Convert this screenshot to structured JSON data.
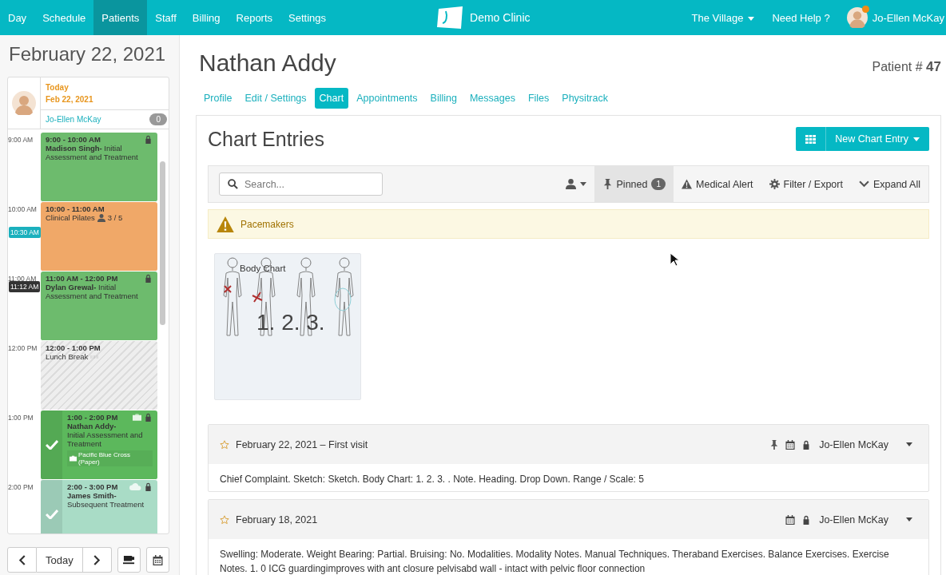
{
  "nav": {
    "items": [
      {
        "label": "Day",
        "selected": false
      },
      {
        "label": "Schedule",
        "selected": false
      },
      {
        "label": "Patients",
        "selected": true
      },
      {
        "label": "Staff",
        "selected": false
      },
      {
        "label": "Billing",
        "selected": false
      },
      {
        "label": "Reports",
        "selected": false
      },
      {
        "label": "Settings",
        "selected": false
      }
    ],
    "brand": "Demo Clinic",
    "location": "The Village",
    "help": "Need Help ?",
    "user": "Jo-Ellen McKay"
  },
  "sidebar": {
    "date": "February 22, 2021",
    "day_label": "Today",
    "day_date": "Feb 22, 2021",
    "staff": "Jo-Ellen McKay",
    "staff_count": "0",
    "times": [
      "9:00 AM",
      "10:00 AM",
      "11:00 AM",
      "12:00 PM",
      "1:00 PM",
      "2:00 PM"
    ],
    "markers": [
      {
        "kind": "hover",
        "label": "10:30 AM"
      },
      {
        "kind": "now",
        "label": "11:12 AM"
      }
    ],
    "appointments": [
      {
        "kind": "appointment",
        "color": "#6dbb6d",
        "time": "9:00 - 10:00 AM",
        "name": "Madison Singh-",
        "desc": "Initial Assessment and Treatment",
        "insured": false,
        "online": false,
        "locked": true,
        "checked": false
      },
      {
        "kind": "class",
        "color": "#f0a868",
        "time": "10:00 - 11:00 AM",
        "desc": "Clinical Pilates",
        "capacity": "3 / 5"
      },
      {
        "kind": "appointment",
        "color": "#6dbb6d",
        "time": "11:00 AM - 12:00 PM",
        "name": "Dylan Grewal-",
        "desc": "Initial Assessment and Treatment",
        "insured": false,
        "online": false,
        "locked": true,
        "checked": false
      },
      {
        "kind": "break",
        "time": "12:00 - 1:00 PM",
        "desc": "Lunch Break"
      },
      {
        "kind": "appointment",
        "color": "#5cb85c",
        "time": "1:00 - 2:00 PM",
        "name": "Nathan Addy-",
        "desc": "Initial Assessment and Treatment",
        "insurance": "Pacific Blue Cross (Paper)",
        "insured": true,
        "online": false,
        "locked": true,
        "checked": true
      },
      {
        "kind": "appointment",
        "color": "#a9dcc6",
        "time": "2:00 - 3:00 PM",
        "name": "James Smith-",
        "desc": "Subsequent Treatment",
        "insured": false,
        "online": true,
        "locked": true,
        "checked": true
      }
    ],
    "today_button": "Today"
  },
  "patient": {
    "name": "Nathan Addy",
    "number": "Patient # **47**",
    "tabs": [
      {
        "label": "Profile",
        "selected": false
      },
      {
        "label": "Edit / Settings",
        "selected": false
      },
      {
        "label": "Chart",
        "selected": true
      },
      {
        "label": "Appointments",
        "selected": false
      },
      {
        "label": "Billing",
        "selected": false
      },
      {
        "label": "Messages",
        "selected": false
      },
      {
        "label": "Files",
        "selected": false
      },
      {
        "label": "Physitrack",
        "selected": false
      }
    ]
  },
  "chart": {
    "title": "Chart Entries",
    "new_button": "New Chart Entry",
    "search": {
      "placeholder": "Search..."
    },
    "pinned": {
      "label": "Pinned",
      "count": "1",
      "selected": true
    },
    "toolbar": [
      "Medical Alert",
      "Filter / Export",
      "Expand All"
    ],
    "alert": "Pacemakers",
    "body_chart": {
      "label": "Body Chart",
      "text": "1. 2. 3."
    },
    "entries": [
      {
        "title": "February 22, 2021 – First visit",
        "pinned": true,
        "author": "Jo-Ellen McKay",
        "body": "Chief Complaint. Sketch: Sketch. Body Chart: 1. 2. 3. . Note. Heading. Drop Down. Range / Scale: 5"
      },
      {
        "title": "February 18, 2021",
        "pinned": false,
        "author": "Jo-Ellen McKay",
        "body": "Swelling: Moderate. Weight Bearing: Partial. Bruising: No. Modalities. Modality Notes. Manual Techniques. Theraband Exercises. Balance Exercises. Exercise Notes. 1. 0 ICG guardingimproves with ant closure pelvisabd wall - intact with pelvic floor connection"
      }
    ]
  }
}
